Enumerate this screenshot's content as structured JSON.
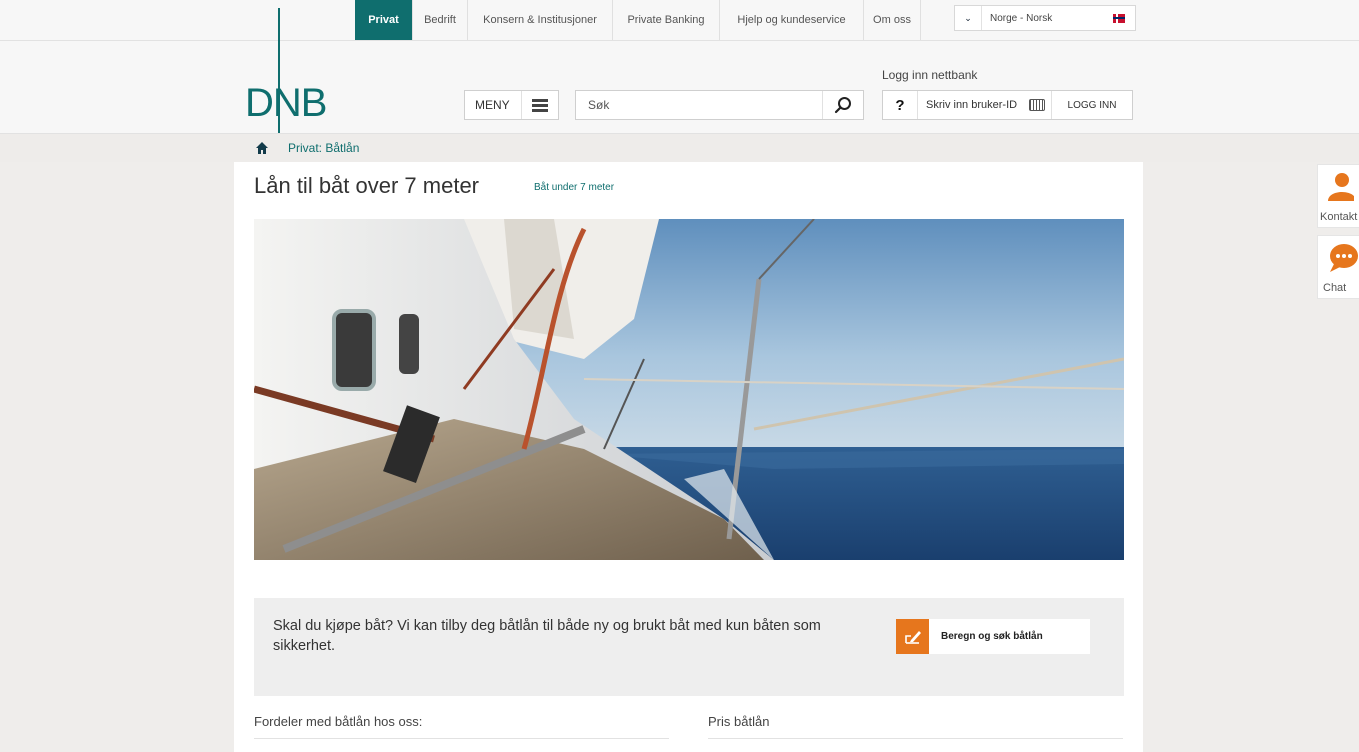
{
  "topnav": {
    "items": [
      "Privat",
      "Bedrift",
      "Konsern & Institusjoner",
      "Private Banking",
      "Hjelp og kundeservice",
      "Om oss"
    ],
    "active_index": 0,
    "country": "Norge - Norsk"
  },
  "header": {
    "logo": "DNB",
    "menu_label": "MENY",
    "search_placeholder": "Søk",
    "login_label": "Logg inn nettbank",
    "login_help": "?",
    "userid_placeholder": "Skriv inn bruker-ID",
    "login_button": "LOGG INN"
  },
  "breadcrumb": {
    "current": "Privat: Båtlån"
  },
  "main": {
    "title": "Lån til båt over 7 meter",
    "subtitle_link": "Båt under 7 meter",
    "info_text": "Skal du kjøpe båt? Vi kan tilby deg båtlån til både ny og brukt båt med kun båten som sikkerhet.",
    "calc_button": "Beregn og søk båtlån",
    "col1_heading": "Fordeler med båtlån hos oss:",
    "col2_heading": "Pris båtlån"
  },
  "side": {
    "contact_label": "Kontakt",
    "chat_label": "Chat"
  },
  "colors": {
    "brand": "#0f6e6e",
    "accent": "#e6761d"
  }
}
